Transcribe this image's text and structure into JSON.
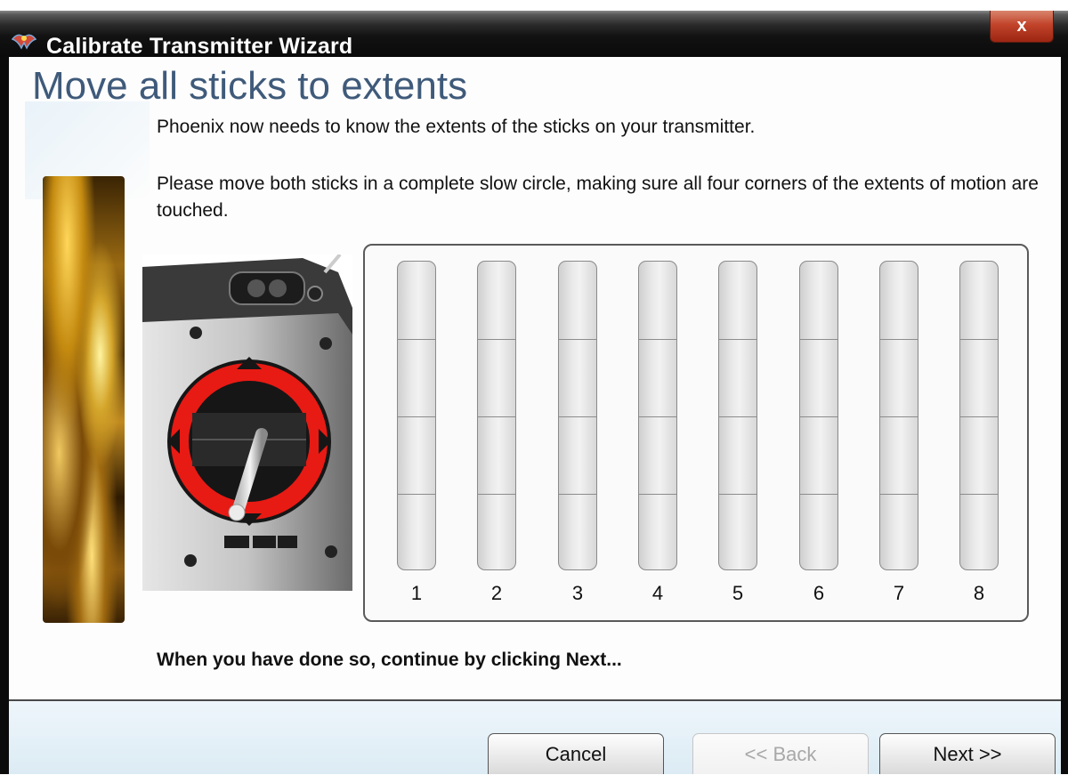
{
  "window": {
    "title": "Calibrate Transmitter Wizard",
    "close_label": "x"
  },
  "page": {
    "heading": "Move all sticks to extents",
    "intro": "Phoenix now needs to know the extents of the sticks on your transmitter.",
    "instructions": "Please move both sticks in a complete slow circle, making sure all four corners of the extents of motion are touched.",
    "continue_text": "When you have done so, continue by clicking Next..."
  },
  "channels": [
    {
      "label": "1",
      "level": 0
    },
    {
      "label": "2",
      "level": 0
    },
    {
      "label": "3",
      "level": 0
    },
    {
      "label": "4",
      "level": 0
    },
    {
      "label": "5",
      "level": 0
    },
    {
      "label": "6",
      "level": 0
    },
    {
      "label": "7",
      "level": 0
    },
    {
      "label": "8",
      "level": 0
    }
  ],
  "buttons": {
    "cancel": "Cancel",
    "back": "<< Back",
    "next": "Next >>",
    "back_enabled": false
  },
  "colors": {
    "heading": "#3f5a7a",
    "arrow_red": "#e81a14",
    "close_red": "#c1432a"
  },
  "icons": {
    "title_icon": "phoenix-logo-icon",
    "close_icon": "close-icon"
  }
}
